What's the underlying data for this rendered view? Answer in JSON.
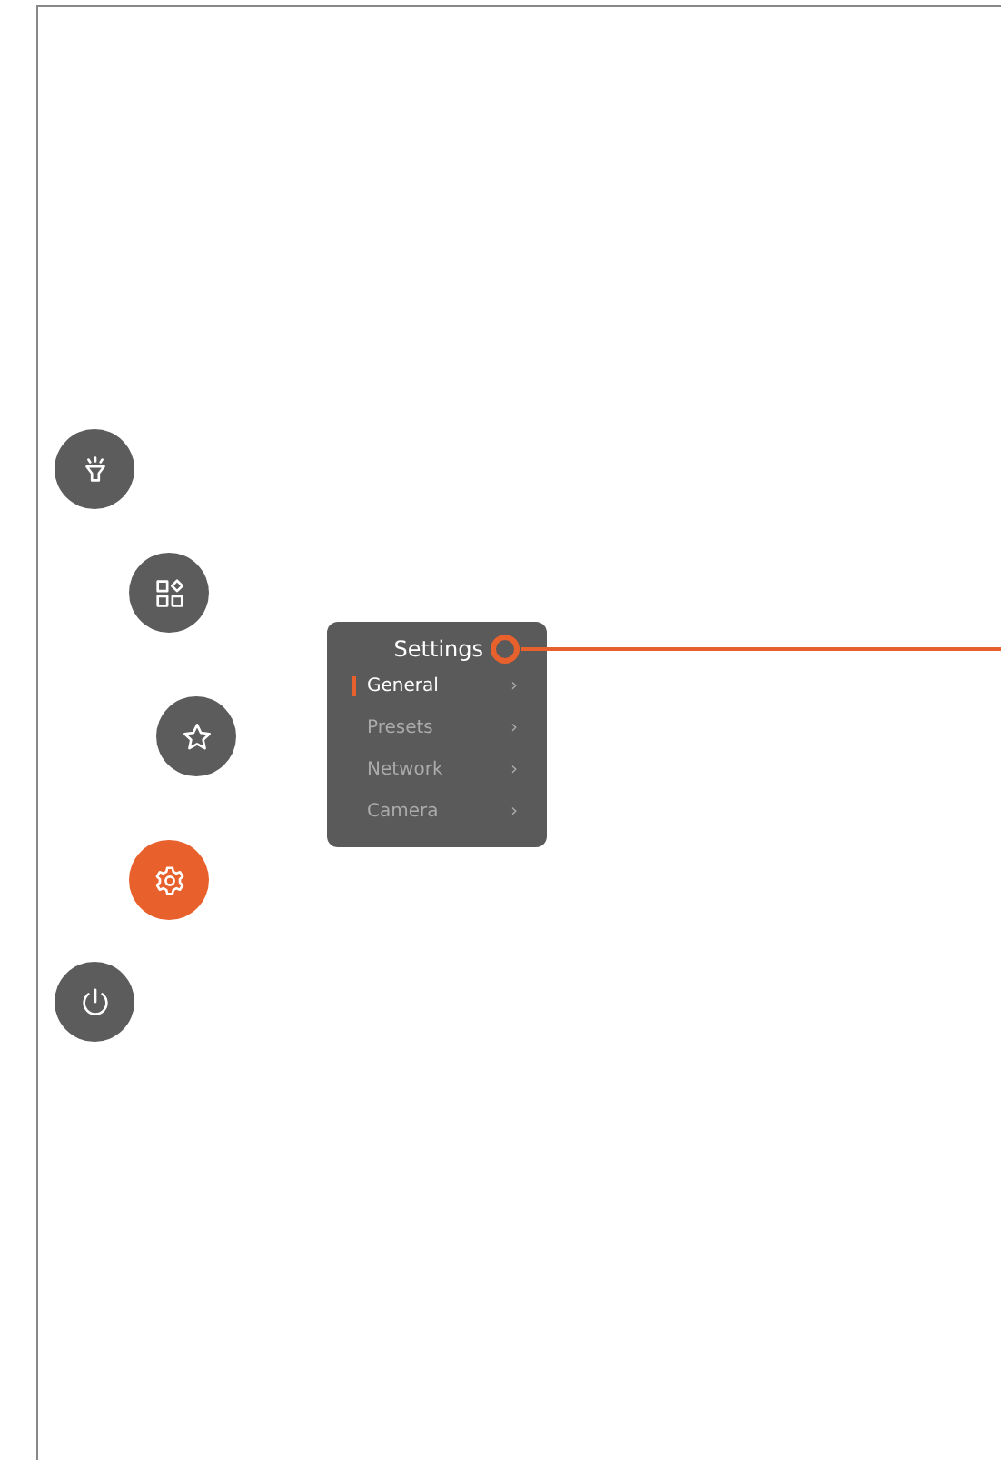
{
  "dial_buttons": [
    {
      "kind": "flashlight",
      "selected": false
    },
    {
      "kind": "apps",
      "selected": false
    },
    {
      "kind": "star",
      "selected": false
    },
    {
      "kind": "settings",
      "selected": true
    },
    {
      "kind": "power",
      "selected": false
    }
  ],
  "menu": {
    "title": "Settings",
    "items": [
      {
        "label": "General",
        "chevron": "›",
        "selected": true
      },
      {
        "label": "Presets",
        "chevron": "›",
        "selected": false
      },
      {
        "label": "Network",
        "chevron": "›",
        "selected": false
      },
      {
        "label": "Camera",
        "chevron": "›",
        "selected": false
      }
    ]
  }
}
